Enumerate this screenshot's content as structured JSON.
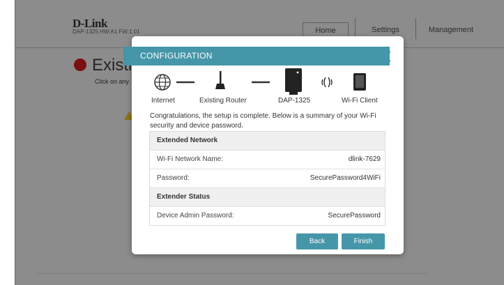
{
  "background": {
    "brand": "D-Link",
    "model_line": "DAP-1325   HW:A1   FW:1.01",
    "nav": {
      "home": "Home",
      "settings": "Settings",
      "management": "Management"
    },
    "page_title": "Existi",
    "page_subtitle": "Click on any"
  },
  "modal": {
    "title": "CONFIGURATION",
    "topology": {
      "internet": "Internet",
      "existing_router": "Existing Router",
      "device": "DAP-1325",
      "wifi_client": "Wi-Fi Client"
    },
    "description": "Congratulations, the setup is complete. Below is a summary of your Wi-Fi security and device password.",
    "summary": {
      "extended_network_header": "Extended Network",
      "wifi_name_label": "Wi-Fi Network Name:",
      "wifi_name_value": "dlink-7629",
      "password_label": "Password:",
      "password_value": "SecurePassword4WiFi",
      "extender_status_header": "Extender Status",
      "admin_password_label": "Device Admin Password:",
      "admin_password_value": "SecurePassword"
    },
    "buttons": {
      "back": "Back",
      "finish": "Finish"
    }
  },
  "colors": {
    "accent": "#4596a9",
    "overlay": "#8c8c8c"
  }
}
